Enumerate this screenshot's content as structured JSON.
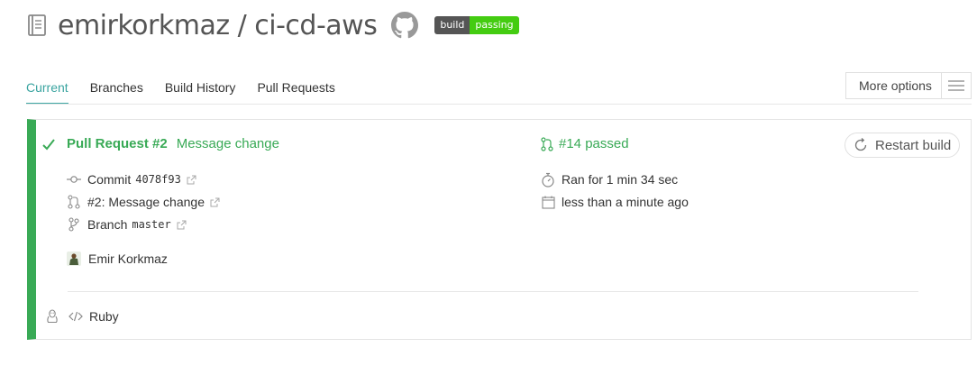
{
  "header": {
    "owner": "emirkorkmaz",
    "separator": " / ",
    "repo": "ci-cd-aws",
    "badge_left": "build",
    "badge_right": "passing"
  },
  "tabs": [
    {
      "label": "Current",
      "active": true
    },
    {
      "label": "Branches",
      "active": false
    },
    {
      "label": "Build History",
      "active": false
    },
    {
      "label": "Pull Requests",
      "active": false
    }
  ],
  "more_options_label": "More options",
  "build": {
    "status_icon": "check-icon",
    "pr_label": "Pull Request #2",
    "pr_message": "Message change",
    "commit_label": "Commit",
    "commit_sha": "4078f93",
    "pr_ref": "#2: Message change",
    "branch_label": "Branch",
    "branch_name": "master",
    "author": "Emir Korkmaz",
    "build_number": "#14 passed",
    "duration": "Ran for 1 min 34 sec",
    "finished": "less than a minute ago",
    "restart_label": "Restart build",
    "language": "Ruby"
  },
  "colors": {
    "passed": "#39aa56",
    "tab_active": "#3aa4a0",
    "badge_pass": "#44cc11"
  }
}
